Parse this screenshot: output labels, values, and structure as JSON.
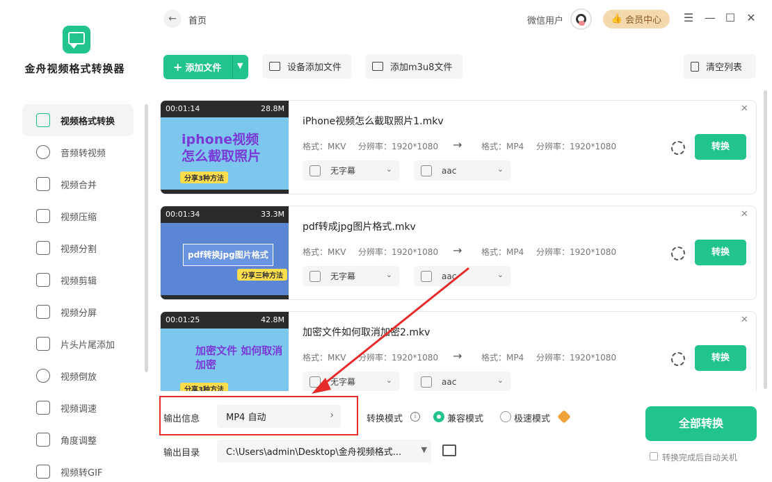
{
  "app": {
    "name": "金舟视频格式转换器"
  },
  "sidebar": {
    "items": [
      {
        "label": "视频格式转换",
        "icon": "convert-icon",
        "active": true
      },
      {
        "label": "音频转视频",
        "icon": "audio-disc-icon"
      },
      {
        "label": "视频合并",
        "icon": "merge-icon"
      },
      {
        "label": "视频压缩",
        "icon": "compress-icon"
      },
      {
        "label": "视频分割",
        "icon": "split-icon"
      },
      {
        "label": "视频剪辑",
        "icon": "scissors-icon"
      },
      {
        "label": "视频分屏",
        "icon": "split-screen-icon"
      },
      {
        "label": "片头片尾添加",
        "icon": "film-icon"
      },
      {
        "label": "视频倒放",
        "icon": "reverse-icon"
      },
      {
        "label": "视频调速",
        "icon": "speed-icon"
      },
      {
        "label": "角度调整",
        "icon": "rotate-icon"
      },
      {
        "label": "视频转GIF",
        "icon": "gif-icon"
      }
    ]
  },
  "header": {
    "breadcrumb": "首页",
    "user_name": "微信用户",
    "vip_label": "会员中心"
  },
  "toolbar": {
    "add_file": "添加文件",
    "device_add": "设备添加文件",
    "add_m3u8": "添加m3u8文件",
    "clear_list": "清空列表"
  },
  "files": [
    {
      "name": "iPhone视频怎么截取照片1.mkv",
      "duration": "00:01:14",
      "size": "28.8M",
      "thumb_title": "iphone视频\n怎么截取照片",
      "thumb_sticker": "分享3种方法",
      "src_format": "格式：MKV",
      "src_res": "分辨率：1920*1080",
      "dst_format": "格式：MP4",
      "dst_res": "分辨率：1920*1080",
      "subtitle": "无字幕",
      "audio": "aac",
      "convert_label": "转换"
    },
    {
      "name": "pdf转成jpg图片格式.mkv",
      "duration": "00:01:34",
      "size": "33.3M",
      "thumb_title": "pdf转换jpg图片格式",
      "thumb_sticker": "分享三种方法",
      "src_format": "格式：MKV",
      "src_res": "分辨率：1920*1080",
      "dst_format": "格式：MP4",
      "dst_res": "分辨率：1920*1080",
      "subtitle": "无字幕",
      "audio": "aac",
      "convert_label": "转换"
    },
    {
      "name": "加密文件如何取消加密2.mkv",
      "duration": "00:01:25",
      "size": "42.8M",
      "thumb_title": "加密文件\n如何取消加密",
      "thumb_sticker": "分享3种方法",
      "src_format": "格式：MKV",
      "src_res": "分辨率：1920*1080",
      "dst_format": "格式：MP4",
      "dst_res": "分辨率：1920*1080",
      "subtitle": "无字幕",
      "audio": "aac",
      "convert_label": "转换"
    }
  ],
  "bottom": {
    "output_info_label": "输出信息",
    "output_format": "MP4 自动",
    "output_dir_label": "输出目录",
    "output_dir": "C:\\Users\\admin\\Desktop\\金舟视频格式...",
    "mode_label": "转换模式",
    "mode_compat": "兼容模式",
    "mode_fast": "极速模式",
    "convert_all": "全部转换",
    "auto_shutdown": "转换完成后自动关机"
  },
  "colors": {
    "accent": "#21c48c",
    "annotation": "#e62b2b",
    "vip_bg": "#f5d9ae"
  }
}
